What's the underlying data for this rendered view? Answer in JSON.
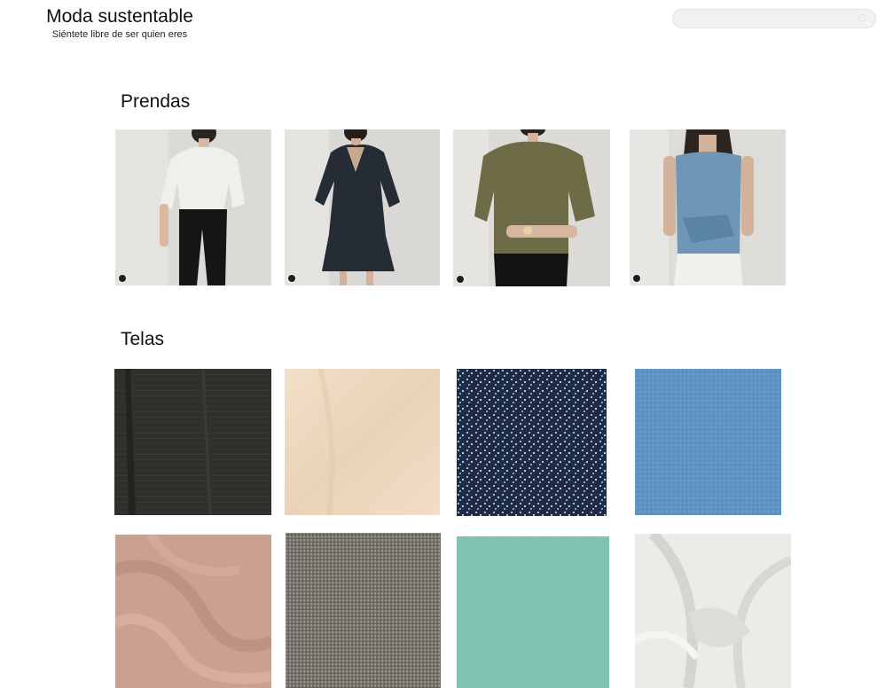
{
  "header": {
    "title": "Moda sustentable",
    "tagline": "Siéntete libre de ser quien eres"
  },
  "search": {
    "placeholder": "",
    "icon": "search-icon"
  },
  "sections": {
    "prendas": {
      "title": "Prendas",
      "items": [
        {
          "name": "white-blouse-black-trousers",
          "top_color": "#ececea",
          "bottom_color": "#161616"
        },
        {
          "name": "navy-wrap-dress",
          "top_color": "#232a33",
          "bottom_color": "#232a33"
        },
        {
          "name": "olive-button-shirt",
          "top_color": "#6f6d47",
          "bottom_color": "#141414"
        },
        {
          "name": "blue-tie-front-top",
          "top_color": "#6f97b5",
          "bottom_color": "#f0efea"
        }
      ]
    },
    "telas": {
      "title": "Telas",
      "items": [
        {
          "name": "fabric-black-linen",
          "color": "#2f302b"
        },
        {
          "name": "fabric-beige-cotton",
          "color": "#eed9bf"
        },
        {
          "name": "fabric-navy-floral",
          "color": "#1e2b46"
        },
        {
          "name": "fabric-blue-chambray",
          "color": "#5f93c2"
        },
        {
          "name": "fabric-dusty-pink-jersey",
          "color": "#caa091"
        },
        {
          "name": "fabric-grey-tweed",
          "color": "#77726c"
        },
        {
          "name": "fabric-mint-crepe",
          "color": "#7fc2b2"
        },
        {
          "name": "fabric-white-satin",
          "color": "#ecebe7"
        }
      ]
    }
  }
}
